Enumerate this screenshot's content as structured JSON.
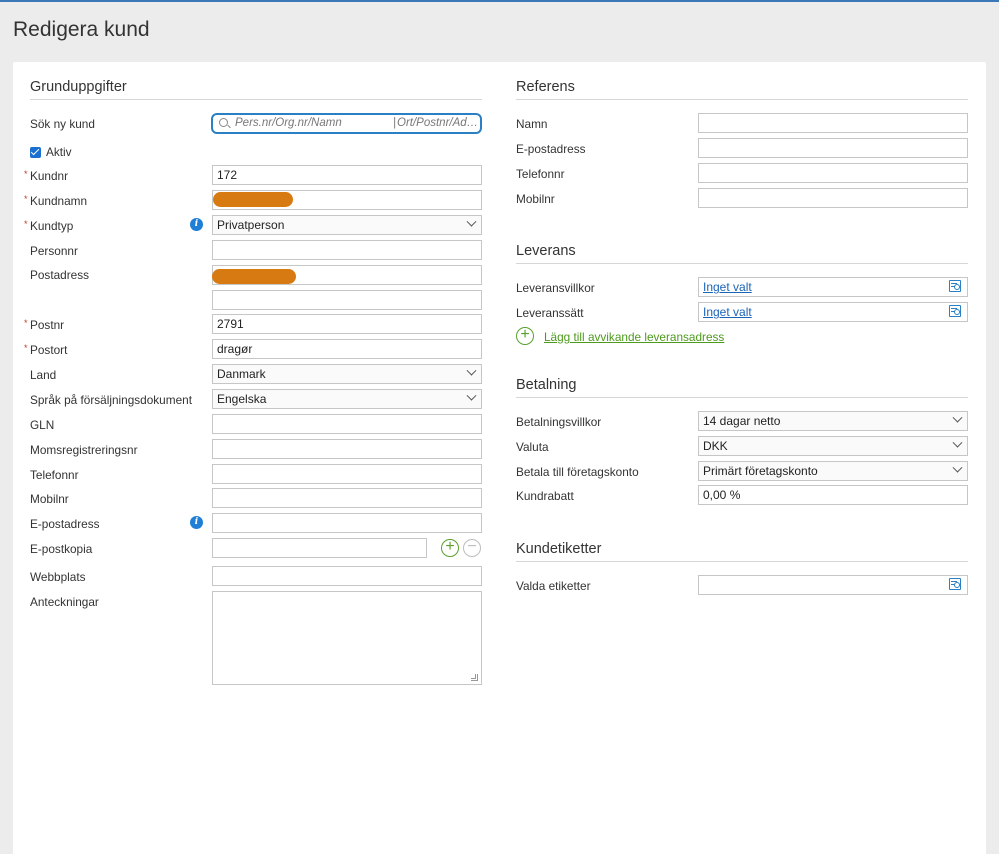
{
  "page": {
    "title": "Redigera kund"
  },
  "grund": {
    "title": "Grunduppgifter",
    "search_label": "Sök ny kund",
    "search_placeholder_1": "Pers.nr/Org.nr/Namn",
    "search_placeholder_2": "Ort/Postnr/Ad…",
    "aktiv_label": "Aktiv",
    "required_mark": "*",
    "kundnr_label": "Kundnr",
    "kundnr_value": "172",
    "kundnamn_label": "Kundnamn",
    "kundtyp_label": "Kundtyp",
    "kundtyp_value": "Privatperson",
    "personnr_label": "Personnr",
    "postadress_label": "Postadress",
    "postnr_label": "Postnr",
    "postnr_value": "2791",
    "postort_label": "Postort",
    "postort_value": "dragør",
    "land_label": "Land",
    "land_value": "Danmark",
    "sprak_label": "Språk på försäljningsdokument",
    "sprak_value": "Engelska",
    "gln_label": "GLN",
    "moms_label": "Momsregistreringsnr",
    "telefon_label": "Telefonnr",
    "mobil_label": "Mobilnr",
    "epost_label": "E-postadress",
    "epostkopia_label": "E-postkopia",
    "webb_label": "Webbplats",
    "anteck_label": "Anteckningar",
    "info_glyph": "i",
    "plus_glyph": "+",
    "minus_glyph": "−"
  },
  "referens": {
    "title": "Referens",
    "namn_label": "Namn",
    "epost_label": "E-postadress",
    "telefon_label": "Telefonnr",
    "mobil_label": "Mobilnr"
  },
  "leverans": {
    "title": "Leverans",
    "villkor_label": "Leveransvillkor",
    "villkor_value": "Inget valt",
    "satt_label": "Leveranssätt",
    "satt_value": "Inget valt",
    "add_label": "Lägg till avvikande leveransadress",
    "plus_glyph": "+"
  },
  "betalning": {
    "title": "Betalning",
    "villkor_label": "Betalningsvillkor",
    "villkor_value": "14 dagar netto",
    "valuta_label": "Valuta",
    "valuta_value": "DKK",
    "konto_label": "Betala till företagskonto",
    "konto_value": "Primärt företagskonto",
    "rabatt_label": "Kundrabatt",
    "rabatt_value": "0,00 %"
  },
  "etiketter": {
    "title": "Kundetiketter",
    "valda_label": "Valda etiketter"
  },
  "colors": {
    "accent": "#2b7fc4",
    "required": "#c0392b",
    "add_green": "#4e9a1e",
    "redaction": "#d87a12"
  }
}
